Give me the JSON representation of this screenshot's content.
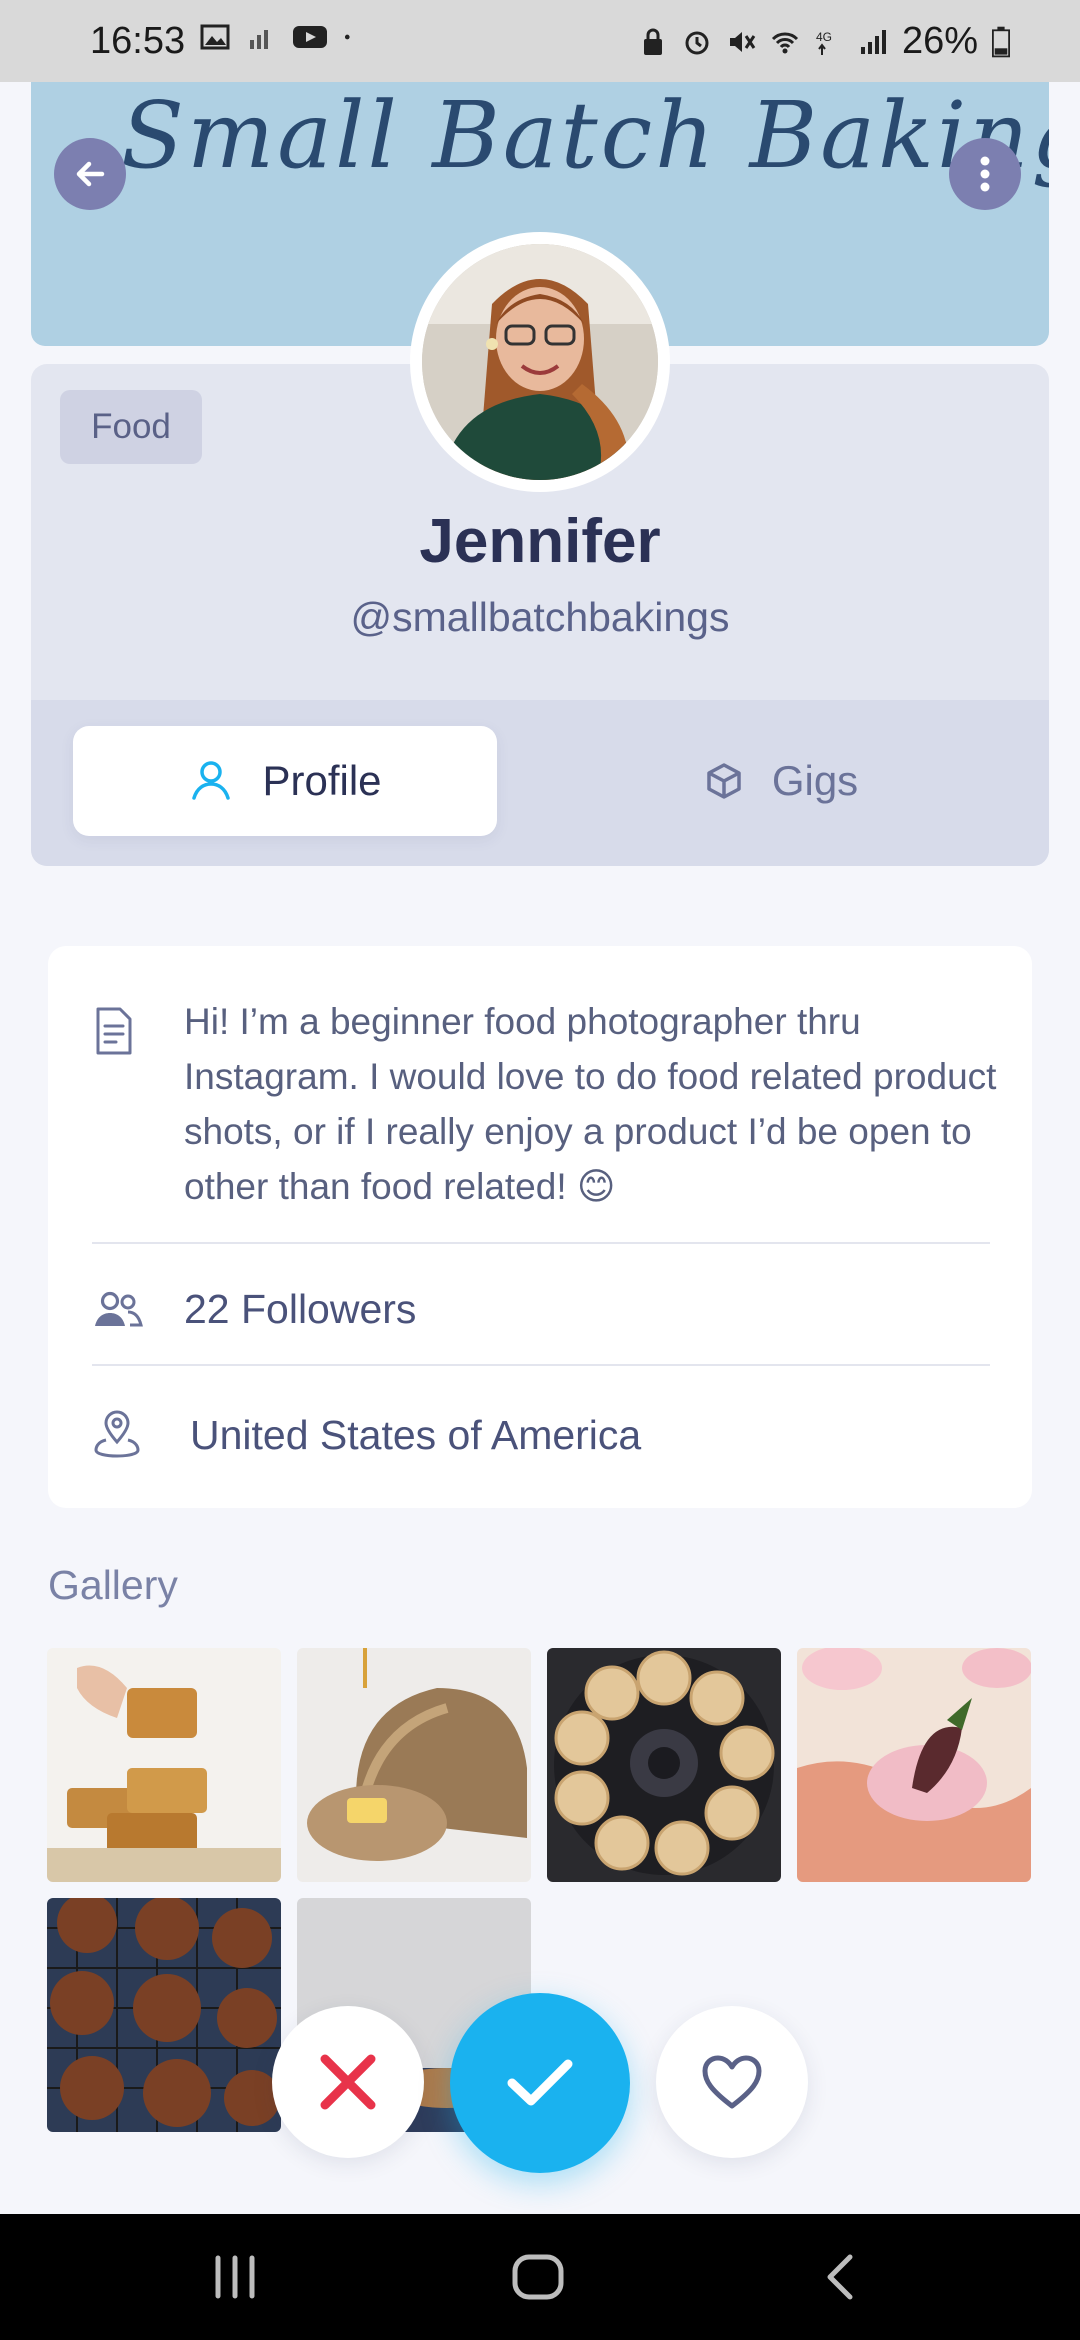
{
  "status_bar": {
    "time": "16:53",
    "battery": "26%"
  },
  "banner": {
    "title": "Small Batch Bakings"
  },
  "profile": {
    "category": "Food",
    "name": "Jennifer",
    "handle": "@smallbatchbakings"
  },
  "tabs": [
    {
      "label": "Profile",
      "active": true
    },
    {
      "label": "Gigs",
      "active": false
    }
  ],
  "about": {
    "bio": "Hi! I’m a beginner food photographer thru Instagram. I would love to do food related product shots, or if I really enjoy a product I’d be open to other than food related! 😊",
    "followers": "22 Followers",
    "location": "United States of America"
  },
  "gallery": {
    "title": "Gallery"
  },
  "colors": {
    "accent": "#1ab2ef",
    "reject": "#e8334a",
    "banner": "#afd0e3"
  },
  "icons": [
    "back-arrow-icon",
    "more-icon",
    "user-icon",
    "cube-icon",
    "document-icon",
    "users-icon",
    "location-pin-icon",
    "close-icon",
    "check-icon",
    "heart-icon"
  ]
}
